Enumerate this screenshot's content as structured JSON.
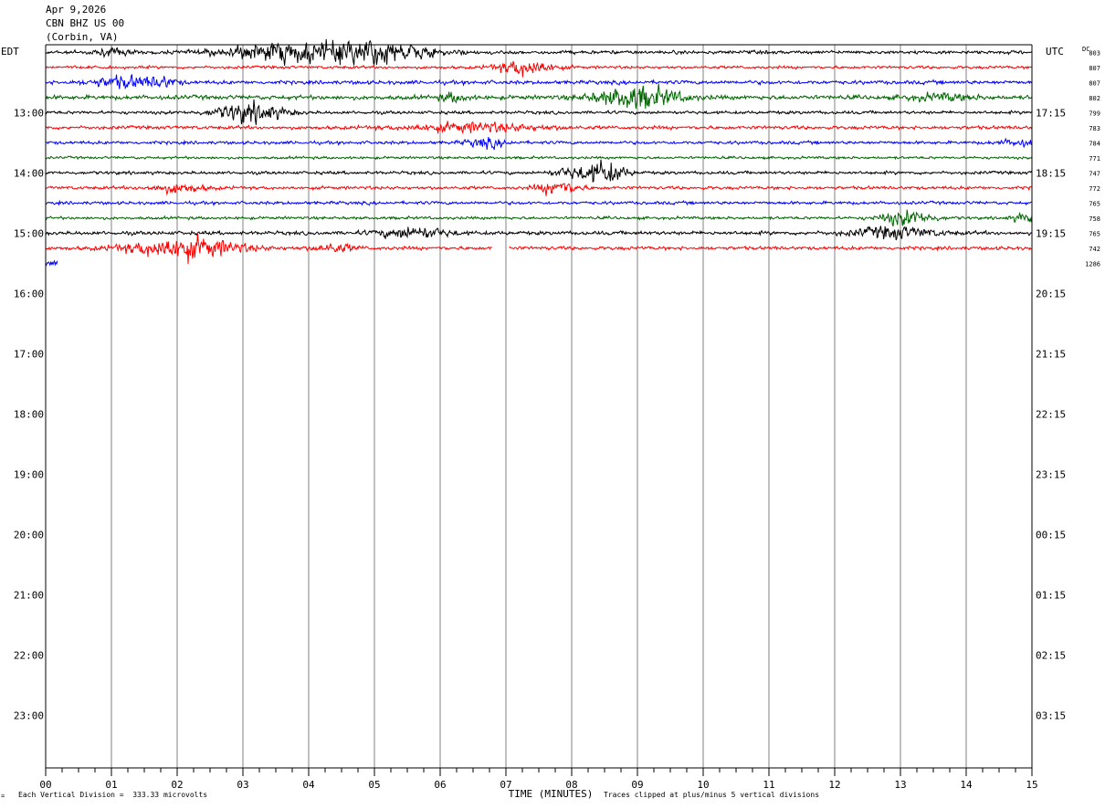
{
  "header": {
    "date": "Apr 9,2026",
    "station": "CBN BHZ US 00",
    "location": "(Corbin, VA)"
  },
  "footer": {
    "scale_note": "Each Vertical Division =  333.33 microvolts",
    "clip_note": "Traces clipped at plus/minus 5 vertical divisions",
    "corner_mark": "="
  },
  "chart_data": {
    "type": "line",
    "title": "Apr 9,2026  CBN BHZ US 00  (Corbin, VA)",
    "xlabel": "TIME (MINUTES)",
    "x_ticks": [
      "00",
      "01",
      "02",
      "03",
      "04",
      "05",
      "06",
      "07",
      "08",
      "09",
      "10",
      "11",
      "12",
      "13",
      "14",
      "15"
    ],
    "xlim": [
      0,
      15
    ],
    "left_axis_label": "EDT",
    "right_axis_label": "UTC",
    "dc_label": "DC",
    "left_hour_labels": [
      "13:00",
      "14:00",
      "15:00",
      "16:00",
      "17:00",
      "18:00",
      "19:00",
      "20:00",
      "21:00",
      "22:00",
      "23:00"
    ],
    "right_hour_labels": [
      "17:15",
      "18:15",
      "19:15",
      "20:15",
      "21:15",
      "22:15",
      "23:15",
      "00:15",
      "01:15",
      "02:15",
      "03:15"
    ],
    "rows_per_hour": 4,
    "total_rows": 48,
    "colors": [
      "#000000",
      "#ff0000",
      "#0000ff",
      "#006400"
    ],
    "traces": [
      {
        "row": 0,
        "color": "#000000",
        "dc": "803",
        "start": 0,
        "end": 15,
        "amp": 1.2,
        "events": [
          [
            3.6,
            0.9,
            6
          ],
          [
            5.0,
            0.8,
            8
          ],
          [
            1.0,
            0.3,
            2
          ]
        ]
      },
      {
        "row": 1,
        "color": "#ff0000",
        "dc": "807",
        "start": 0,
        "end": 15,
        "amp": 1.0,
        "events": [
          [
            7.3,
            0.4,
            6
          ]
        ]
      },
      {
        "row": 2,
        "color": "#0000ff",
        "dc": "807",
        "start": 0,
        "end": 15,
        "amp": 1.3,
        "events": [
          [
            1.2,
            0.5,
            4
          ],
          [
            1.8,
            0.2,
            3
          ]
        ]
      },
      {
        "row": 3,
        "color": "#006400",
        "dc": "802",
        "start": 0,
        "end": 15,
        "amp": 1.5,
        "events": [
          [
            9.0,
            0.6,
            8
          ],
          [
            6.2,
            0.2,
            3
          ],
          [
            13.6,
            0.5,
            2
          ]
        ]
      },
      {
        "row": 4,
        "color": "#000000",
        "dc": "799",
        "start": 0,
        "end": 15,
        "amp": 1.1,
        "events": [
          [
            3.1,
            0.5,
            7
          ]
        ]
      },
      {
        "row": 5,
        "color": "#ff0000",
        "dc": "783",
        "start": 0,
        "end": 15,
        "amp": 1.2,
        "events": [
          [
            6.5,
            1.0,
            3
          ]
        ]
      },
      {
        "row": 6,
        "color": "#0000ff",
        "dc": "784",
        "start": 0,
        "end": 15,
        "amp": 1.1,
        "events": [
          [
            6.7,
            0.3,
            3
          ],
          [
            14.8,
            0.3,
            2
          ]
        ]
      },
      {
        "row": 7,
        "color": "#006400",
        "dc": "771",
        "start": 0,
        "end": 15,
        "amp": 0.9,
        "events": []
      },
      {
        "row": 8,
        "color": "#000000",
        "dc": "747",
        "start": 0,
        "end": 15,
        "amp": 1.1,
        "events": [
          [
            8.5,
            0.3,
            8
          ],
          [
            8.0,
            0.3,
            3
          ]
        ]
      },
      {
        "row": 9,
        "color": "#ff0000",
        "dc": "772",
        "start": 0,
        "end": 15,
        "amp": 1.1,
        "events": [
          [
            7.8,
            0.3,
            5
          ],
          [
            2.0,
            0.4,
            3
          ]
        ]
      },
      {
        "row": 10,
        "color": "#0000ff",
        "dc": "765",
        "start": 0,
        "end": 15,
        "amp": 1.1,
        "events": []
      },
      {
        "row": 11,
        "color": "#006400",
        "dc": "758",
        "start": 0,
        "end": 15,
        "amp": 1.0,
        "events": [
          [
            13.1,
            0.4,
            5
          ],
          [
            14.9,
            0.2,
            3
          ]
        ]
      },
      {
        "row": 12,
        "color": "#000000",
        "dc": "765",
        "start": 0,
        "end": 15,
        "amp": 1.3,
        "events": [
          [
            5.6,
            0.5,
            4
          ],
          [
            12.9,
            0.6,
            4
          ]
        ]
      },
      {
        "row": 13,
        "color": "#ff0000",
        "dc": "742",
        "start": 0,
        "end": 6.8,
        "start2": 7.05,
        "end2": 15,
        "amp": 1.2,
        "events": [
          [
            2.1,
            0.8,
            8
          ],
          [
            4.4,
            0.3,
            3
          ]
        ]
      },
      {
        "row": 14,
        "color": "#0000ff",
        "dc": "1286",
        "start": 0,
        "end": 0.18,
        "amp": 1.8,
        "events": []
      }
    ]
  }
}
